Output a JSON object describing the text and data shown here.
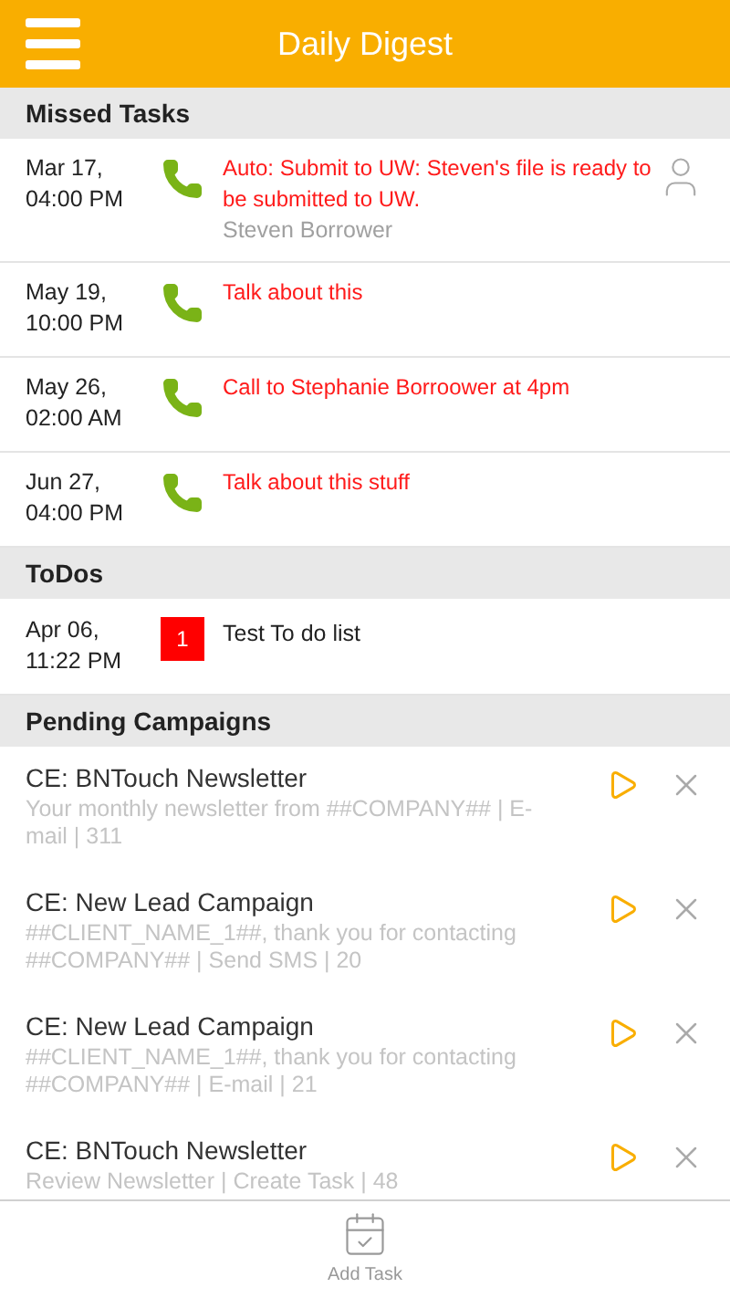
{
  "header": {
    "title": "Daily Digest"
  },
  "sections": [
    {
      "title": "Missed Tasks",
      "kind": "tasks",
      "items": [
        {
          "date": "Mar 17,",
          "time": "04:00 PM",
          "title": "Auto: Submit to UW: Steven's file is ready to be submitted to UW.",
          "contact": "Steven Borrower"
        },
        {
          "date": "May 19,",
          "time": "10:00 PM",
          "title": "Talk about this"
        },
        {
          "date": "May 26,",
          "time": "02:00 AM",
          "title": "Call to Stephanie Borroower at 4pm"
        },
        {
          "date": "Jun 27,",
          "time": "04:00 PM",
          "title": "Talk about this stuff"
        }
      ]
    },
    {
      "title": "ToDos",
      "kind": "todos",
      "items": [
        {
          "date": "Apr 06,",
          "time": "11:22 PM",
          "badge": "1",
          "title": "Test To do list"
        }
      ]
    },
    {
      "title": "Pending Campaigns",
      "kind": "campaigns",
      "items": [
        {
          "title": "CE: BNTouch Newsletter",
          "detail": "Your monthly newsletter from ##COMPANY## | E-mail | 311"
        },
        {
          "title": "CE: New Lead Campaign",
          "detail": "##CLIENT_NAME_1##, thank you for contacting ##COMPANY## | Send SMS | 20"
        },
        {
          "title": "CE: New Lead Campaign",
          "detail": "##CLIENT_NAME_1##, thank you for contacting ##COMPANY## | E-mail | 21"
        },
        {
          "title": "CE: BNTouch Newsletter",
          "detail": "Review Newsletter | Create Task | 48"
        }
      ]
    }
  ],
  "bottom_bar": {
    "action": "Add Task"
  }
}
